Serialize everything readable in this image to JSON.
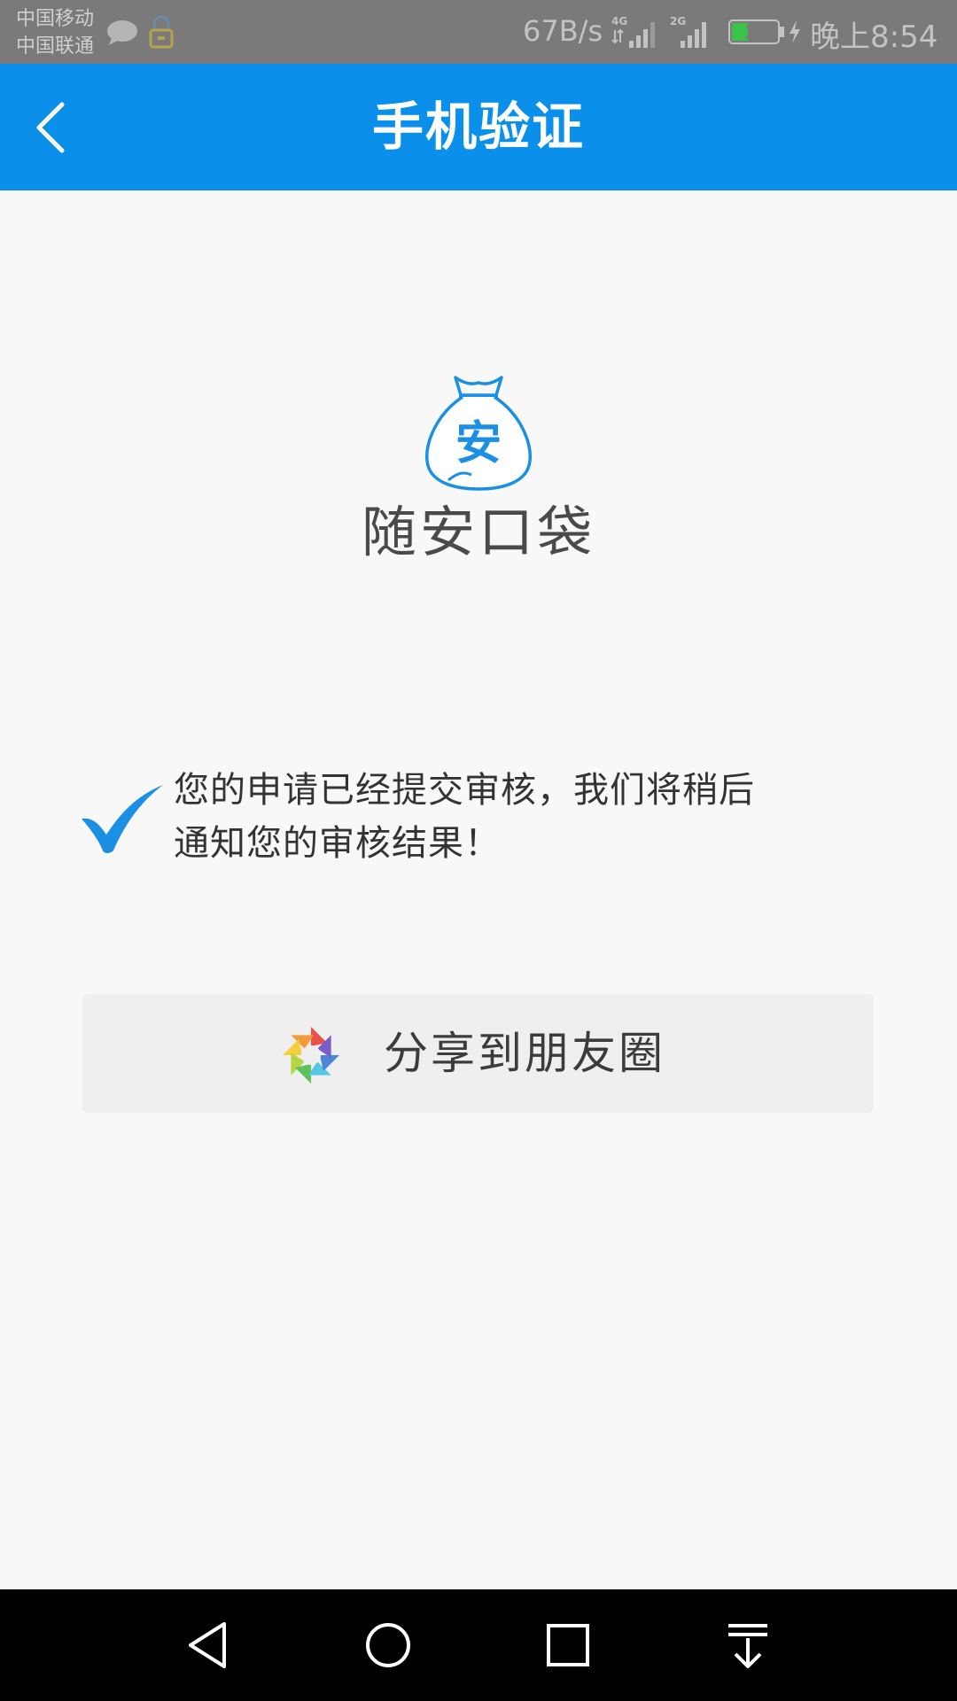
{
  "status_bar": {
    "carrier_1": "中国移动",
    "carrier_2": "中国联通",
    "net_speed": "67B/s",
    "signal_1_type": "4G",
    "signal_2_type": "2G",
    "battery_level": "34",
    "time": "晚上8:54"
  },
  "header": {
    "title": "手机验证",
    "back_icon": "chevron-left-icon",
    "background_color": "#0a90ea"
  },
  "logo": {
    "icon": "money-bag-icon",
    "bag_char": "安",
    "app_name": "随安口袋",
    "accent_color": "#1a8fe4"
  },
  "message": {
    "icon": "checkmark-icon",
    "text": "您的申请已经提交审核，我们将稍后通知您的审核结果！"
  },
  "share": {
    "icon": "wechat-moments-icon",
    "label": "分享到朋友圈"
  },
  "nav_bar": {
    "back_icon": "nav-back-icon",
    "home_icon": "nav-home-icon",
    "recents_icon": "nav-recents-icon",
    "notification_icon": "nav-pulldown-icon"
  }
}
